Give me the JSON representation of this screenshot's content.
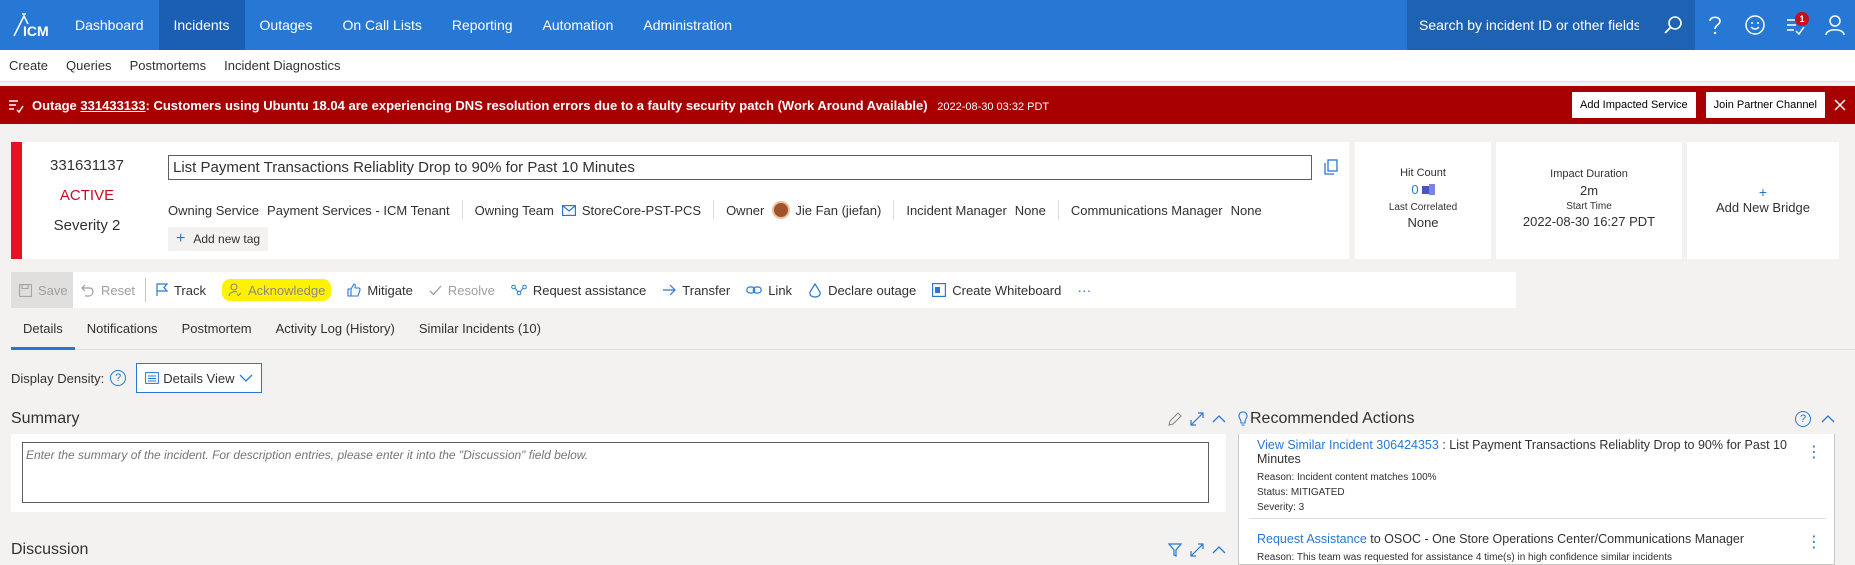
{
  "topnav": {
    "logo": "ICM",
    "items": [
      "Dashboard",
      "Incidents",
      "Outages",
      "On Call Lists",
      "Reporting",
      "Automation",
      "Administration"
    ],
    "active": "Incidents",
    "search_placeholder": "Search by incident ID or other fields...",
    "notification_count": "1"
  },
  "subnav": {
    "items": [
      "Create",
      "Queries",
      "Postmortems",
      "Incident Diagnostics"
    ]
  },
  "banner": {
    "prefix": "Outage",
    "outage_id": "331433133",
    "message": ": Customers using Ubuntu 18.04 are experiencing DNS resolution errors due to a faulty security patch (Work Around Available)",
    "time": "2022-08-30 03:32 PDT",
    "add_impacted_label": "Add Impacted Service",
    "join_partner_label": "Join Partner Channel",
    "color": "#a80000"
  },
  "incident": {
    "id": "331631137",
    "status": "ACTIVE",
    "severity": "Severity 2",
    "title": "List Payment Transactions Reliablity Drop to 90% for Past 10 Minutes",
    "owning_service_label": "Owning Service",
    "owning_service": "Payment Services - ICM Tenant",
    "owning_team_label": "Owning Team",
    "owning_team": "StoreCore-PST-PCS",
    "owner_label": "Owner",
    "owner": "Jie Fan (jiefan)",
    "incident_manager_label": "Incident Manager",
    "incident_manager": "None",
    "comms_manager_label": "Communications Manager",
    "comms_manager": "None",
    "add_tag_label": "Add new tag"
  },
  "stats": {
    "hit_count_label": "Hit Count",
    "hit_count": "0",
    "last_correlated_label": "Last Correlated",
    "last_correlated": "None",
    "impact_duration_label": "Impact Duration",
    "impact_duration": "2m",
    "start_time_label": "Start Time",
    "start_time": "2022-08-30 16:27 PDT",
    "add_bridge_label": "Add New Bridge"
  },
  "toolbar": {
    "save": "Save",
    "reset": "Reset",
    "track": "Track",
    "acknowledge": "Acknowledge",
    "mitigate": "Mitigate",
    "resolve": "Resolve",
    "request_assistance": "Request assistance",
    "transfer": "Transfer",
    "link": "Link",
    "declare_outage": "Declare outage",
    "create_whiteboard": "Create Whiteboard",
    "more": "···"
  },
  "tabs": [
    "Details",
    "Notifications",
    "Postmortem",
    "Activity Log (History)",
    "Similar Incidents (10)"
  ],
  "density": {
    "label": "Display Density:",
    "value": "Details View"
  },
  "summary": {
    "title": "Summary",
    "placeholder": "Enter the summary of the incident. For description entries, please enter it into the \"Discussion\" field below."
  },
  "discussion": {
    "title": "Discussion"
  },
  "recommended": {
    "title": "Recommended Actions",
    "items": [
      {
        "link": "View Similar Incident 306424353",
        "text": " : List Payment Transactions Reliablity Drop to 90% for Past 10 Minutes",
        "reason": "Reason: Incident content matches 100%",
        "status": "Status: MITIGATED",
        "severity": "Severity: 3"
      },
      {
        "link": "Request Assistance",
        "text": " to OSOC - One Store Operations Center/Communications Manager",
        "reason": "Reason: This team was requested for assistance 4 time(s) in high confidence similar incidents"
      }
    ]
  }
}
